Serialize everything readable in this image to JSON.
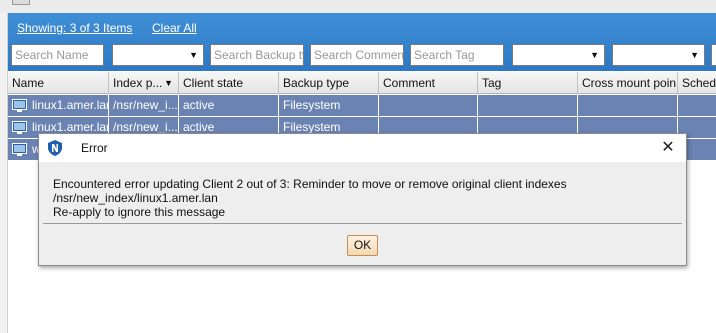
{
  "toolbar": {
    "showing_link": "Showing: 3 of 3 Items",
    "clear_all_link": "Clear All"
  },
  "filters": {
    "search_name": "Search Name",
    "search_backup_type": "Search Backup typ",
    "search_comment": "Search Comment",
    "search_tag": "Search Tag",
    "index_path_select": "",
    "client_state_select": "",
    "tag_select": "",
    "cross_mount_select": ""
  },
  "columns": [
    "Name",
    "Index p...",
    "Client state",
    "Backup type",
    "Comment",
    "Tag",
    "Cross mount poin...",
    "Sched"
  ],
  "rows": [
    {
      "name": "linux1.amer.lan",
      "index_path": "/nsr/new_i...",
      "client_state": "active",
      "backup_type": "Filesystem"
    },
    {
      "name": "linux1.amer.lan",
      "index_path": "/nsr/new_i...",
      "client_state": "active",
      "backup_type": "Filesystem"
    },
    {
      "name": "w",
      "index_path": "",
      "client_state": "",
      "backup_type": ""
    }
  ],
  "dialog": {
    "title": "Error",
    "message_line1": "Encountered error updating Client 2 out of 3: Reminder to move or remove original client indexes /nsr/new_index/linux1.amer.lan",
    "message_line2": "Re-apply to ignore this message",
    "ok_label": "OK"
  },
  "colors": {
    "panel_blue": "#3f8fd6",
    "row_selected": "#6b83b3",
    "ok_button_border": "#c48d55"
  }
}
